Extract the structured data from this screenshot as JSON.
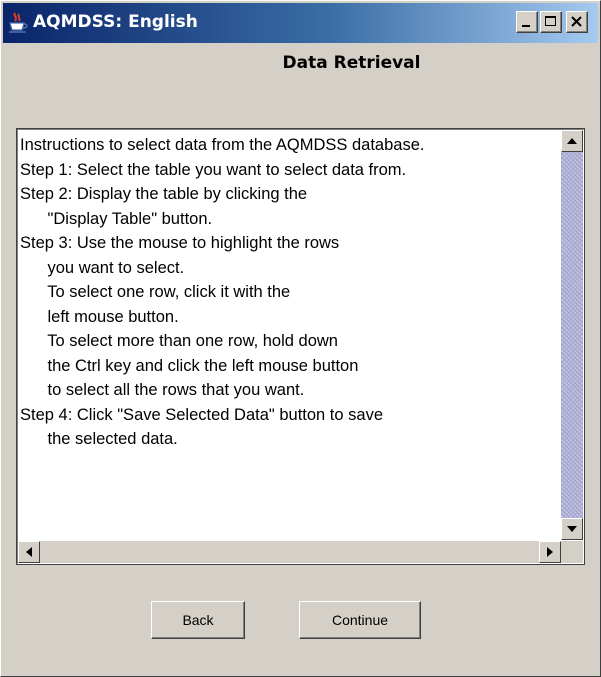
{
  "window": {
    "title": "AQMDSS: English",
    "controls": [
      "minimize-icon",
      "maximize-icon",
      "close-icon"
    ]
  },
  "page": {
    "heading": "Data Retrieval"
  },
  "instructions": {
    "lines": [
      "Instructions to select data from the AQMDSS database.",
      "Step 1: Select the table you want to select data from.",
      "Step 2: Display the table by clicking the",
      "      \"Display Table\" button.",
      "Step 3: Use the mouse to highlight the rows",
      "      you want to select.",
      "      To select one row, click it with the",
      "      left mouse button.",
      "      To select more than one row, hold down",
      "      the Ctrl key and click the left mouse button",
      "      to select all the rows that you want.",
      "Step 4: Click \"Save Selected Data\" button to save",
      "      the selected data."
    ]
  },
  "buttons": {
    "back_label": "Back",
    "continue_label": "Continue"
  },
  "colors": {
    "titlebar_start": "#0a246a",
    "titlebar_end": "#a6caf0",
    "face": "#d4d0c8"
  }
}
